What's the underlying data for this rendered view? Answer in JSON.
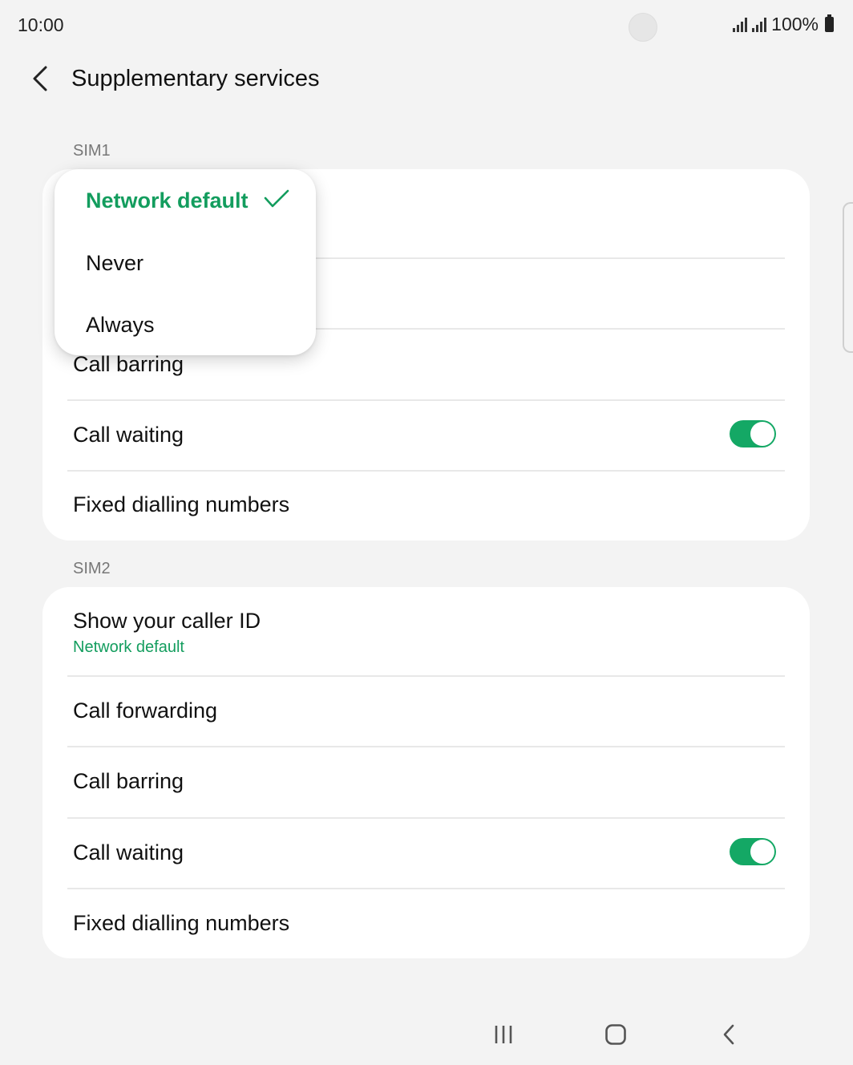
{
  "status_bar": {
    "time": "10:00",
    "battery_text": "100%"
  },
  "header": {
    "title": "Supplementary services"
  },
  "sim1": {
    "label": "SIM1",
    "items": [
      {
        "title": "Call barring"
      },
      {
        "title": "Call waiting",
        "toggle_on": true
      },
      {
        "title": "Fixed dialling numbers"
      }
    ]
  },
  "sim2": {
    "label": "SIM2",
    "items": [
      {
        "title": "Show your caller ID",
        "subtitle": "Network default"
      },
      {
        "title": "Call forwarding"
      },
      {
        "title": "Call barring"
      },
      {
        "title": "Call waiting",
        "toggle_on": true
      },
      {
        "title": "Fixed dialling numbers"
      }
    ]
  },
  "popup": {
    "options": [
      {
        "label": "Network default",
        "selected": true
      },
      {
        "label": "Never",
        "selected": false
      },
      {
        "label": "Always",
        "selected": false
      }
    ]
  },
  "colors": {
    "accent": "#139d5e",
    "toggle": "#14a865",
    "background": "#f3f3f3"
  },
  "icons": [
    "back-arrow-icon",
    "check-icon",
    "recent-apps-icon",
    "home-icon",
    "nav-back-icon",
    "signal-icon",
    "battery-icon"
  ]
}
